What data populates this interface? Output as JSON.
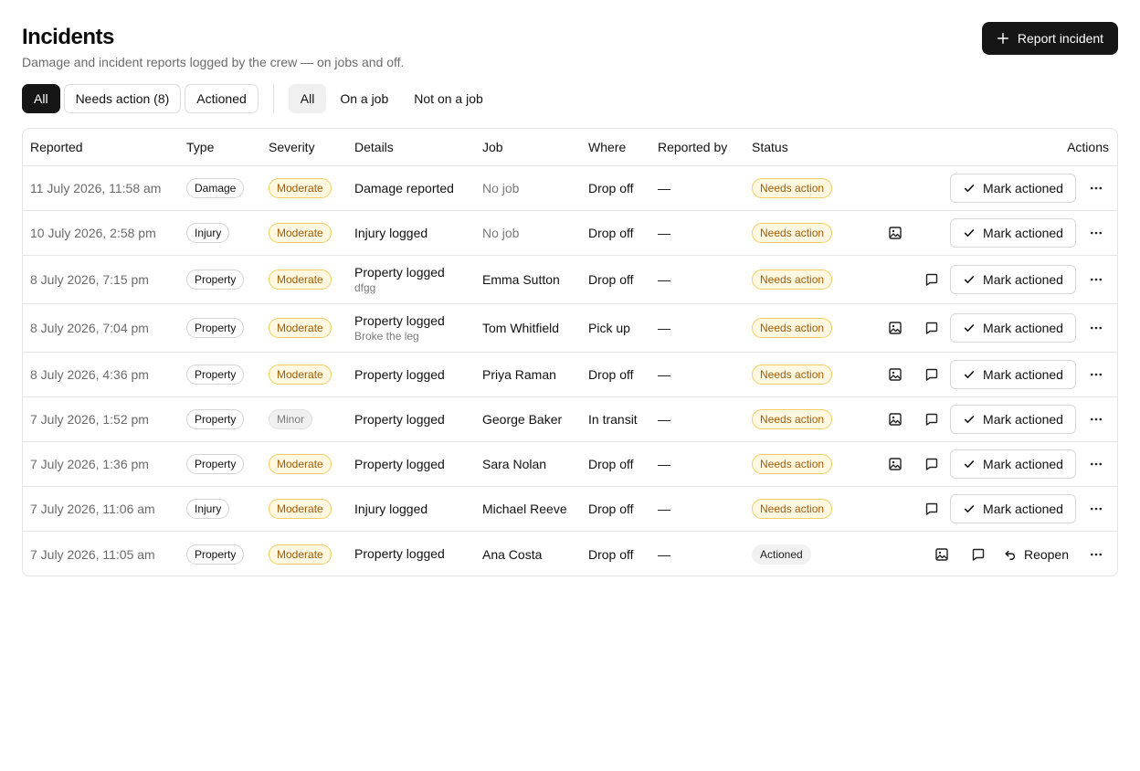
{
  "header": {
    "title": "Incidents",
    "subtitle": "Damage and incident reports logged by the crew — on jobs and off.",
    "report_button": "Report incident"
  },
  "status_filters": [
    {
      "label": "All",
      "active": true
    },
    {
      "label": "Needs action (8)",
      "active": false
    },
    {
      "label": "Actioned",
      "active": false
    }
  ],
  "scope_filters": [
    {
      "label": "All",
      "active": true
    },
    {
      "label": "On a job",
      "active": false
    },
    {
      "label": "Not on a job",
      "active": false
    }
  ],
  "table": {
    "columns": [
      "Reported",
      "Type",
      "Severity",
      "Details",
      "Job",
      "Where",
      "Reported by",
      "Status",
      "Actions"
    ],
    "rows": [
      {
        "reported": "11 July 2026, 11:58 am",
        "type": "Damage",
        "severity": "Moderate",
        "details": "Damage reported",
        "details_note": "",
        "job": "No job",
        "where": "Drop off",
        "reported_by": "—",
        "status": "Needs action",
        "has_photo": false,
        "has_comment": false,
        "action": "Mark actioned"
      },
      {
        "reported": "10 July 2026, 2:58 pm",
        "type": "Injury",
        "severity": "Moderate",
        "details": "Injury logged",
        "details_note": "",
        "job": "No job",
        "where": "Drop off",
        "reported_by": "—",
        "status": "Needs action",
        "has_photo": true,
        "has_comment": false,
        "action": "Mark actioned"
      },
      {
        "reported": "8 July 2026, 7:15 pm",
        "type": "Property",
        "severity": "Moderate",
        "details": "Property logged",
        "details_note": "dfgg",
        "job": "Emma Sutton",
        "where": "Drop off",
        "reported_by": "—",
        "status": "Needs action",
        "has_photo": false,
        "has_comment": true,
        "action": "Mark actioned"
      },
      {
        "reported": "8 July 2026, 7:04 pm",
        "type": "Property",
        "severity": "Moderate",
        "details": "Property logged",
        "details_note": "Broke the leg",
        "job": "Tom Whitfield",
        "where": "Pick up",
        "reported_by": "—",
        "status": "Needs action",
        "has_photo": true,
        "has_comment": true,
        "action": "Mark actioned"
      },
      {
        "reported": "8 July 2026, 4:36 pm",
        "type": "Property",
        "severity": "Moderate",
        "details": "Property logged",
        "details_note": "",
        "job": "Priya Raman",
        "where": "Drop off",
        "reported_by": "—",
        "status": "Needs action",
        "has_photo": true,
        "has_comment": true,
        "action": "Mark actioned"
      },
      {
        "reported": "7 July 2026, 1:52 pm",
        "type": "Property",
        "severity": "Minor",
        "details": "Property logged",
        "details_note": "",
        "job": "George Baker",
        "where": "In transit",
        "reported_by": "—",
        "status": "Needs action",
        "has_photo": true,
        "has_comment": true,
        "action": "Mark actioned"
      },
      {
        "reported": "7 July 2026, 1:36 pm",
        "type": "Property",
        "severity": "Moderate",
        "details": "Property logged",
        "details_note": "",
        "job": "Sara Nolan",
        "where": "Drop off",
        "reported_by": "—",
        "status": "Needs action",
        "has_photo": true,
        "has_comment": true,
        "action": "Mark actioned"
      },
      {
        "reported": "7 July 2026, 11:06 am",
        "type": "Injury",
        "severity": "Moderate",
        "details": "Injury logged",
        "details_note": "",
        "job": "Michael Reeve",
        "where": "Drop off",
        "reported_by": "—",
        "status": "Needs action",
        "has_photo": false,
        "has_comment": true,
        "action": "Mark actioned"
      },
      {
        "reported": "7 July 2026, 11:05 am",
        "type": "Property",
        "severity": "Moderate",
        "details": "Property logged",
        "details_note": "",
        "job": "Ana Costa",
        "where": "Drop off",
        "reported_by": "—",
        "status": "Actioned",
        "has_photo": true,
        "has_comment": true,
        "action": "Reopen"
      }
    ]
  },
  "icons": {
    "report": "plus-icon",
    "mark": "check-icon",
    "reopen": "undo-icon",
    "photo": "image-icon",
    "comment": "comment-icon",
    "more": "more-horizontal-icon"
  },
  "colors": {
    "primary": "#161616",
    "warning_bg": "#fff8e1",
    "warning_border": "#f1cd63",
    "warning_text": "#a15c07",
    "border": "#e4e4e4"
  }
}
